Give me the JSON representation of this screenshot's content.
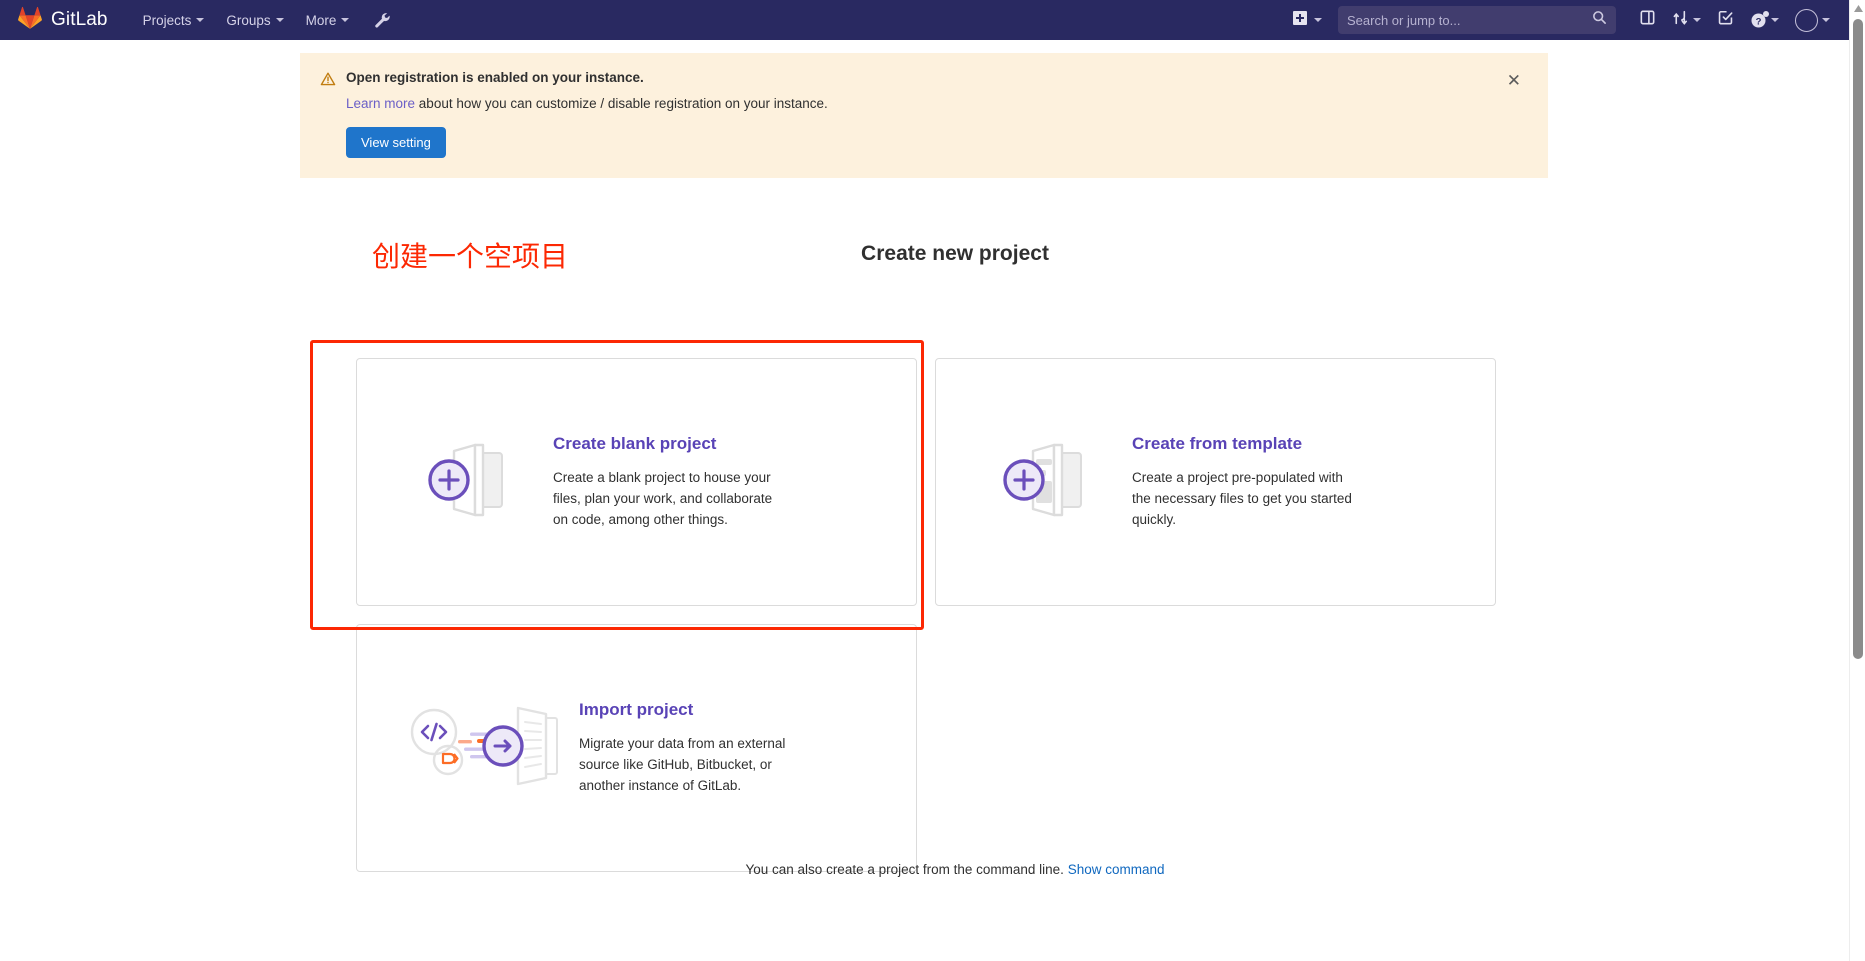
{
  "navbar": {
    "brand": "GitLab",
    "links": [
      {
        "label": "Projects",
        "name": "nav-projects"
      },
      {
        "label": "Groups",
        "name": "nav-groups"
      },
      {
        "label": "More",
        "name": "nav-more"
      }
    ],
    "wrench_icon": "wrench-icon",
    "new_icon": "plus-square-icon",
    "search": {
      "placeholder": "Search or jump to...",
      "value": "",
      "icon": "search-icon"
    },
    "icons": [
      {
        "name": "issues-board-icon",
        "glyph": "issue-board"
      },
      {
        "name": "merge-requests-icon",
        "glyph": "merge-request"
      },
      {
        "name": "todos-icon",
        "glyph": "todo-check"
      },
      {
        "name": "help-icon",
        "glyph": "question-circle"
      }
    ],
    "avatar": "user-avatar",
    "colors": {
      "background": "#292961",
      "search_field": "#413d6e"
    }
  },
  "alert": {
    "icon": "warning-triangle-icon",
    "title": "Open registration is enabled on your instance.",
    "link_text": "Learn more",
    "description": " about how you can customize / disable registration on your instance.",
    "button": "View setting",
    "close_icon": "close-icon",
    "colors": {
      "background": "#fdf1dd",
      "button": "#1f75cb"
    }
  },
  "main": {
    "page_title": "Create new project",
    "annotation": "创建一个空项目",
    "annotation_color": "#fc2803",
    "highlight_color": "#fc2803",
    "cards": [
      {
        "name": "create-blank-project-card",
        "title": "Create blank project",
        "description": "Create a blank project to house your files, plan your work, and collaborate on code, among other things.",
        "illustration": "blank-project-icon",
        "highlighted": true
      },
      {
        "name": "create-from-template-card",
        "title": "Create from template",
        "description": "Create a project pre-populated with the necessary files to get you started quickly.",
        "illustration": "template-project-icon",
        "highlighted": false
      },
      {
        "name": "import-project-card",
        "title": "Import project",
        "description": "Migrate your data from an external source like GitHub, Bitbucket, or another instance of GitLab.",
        "illustration": "import-project-icon",
        "highlighted": false
      }
    ],
    "footer": {
      "text": "You can also create a project from the command line. ",
      "link": "Show command"
    }
  },
  "scrollbar": {
    "up_arrow_icon": "scroll-up-arrow-icon",
    "thumb": "scroll-thumb"
  }
}
